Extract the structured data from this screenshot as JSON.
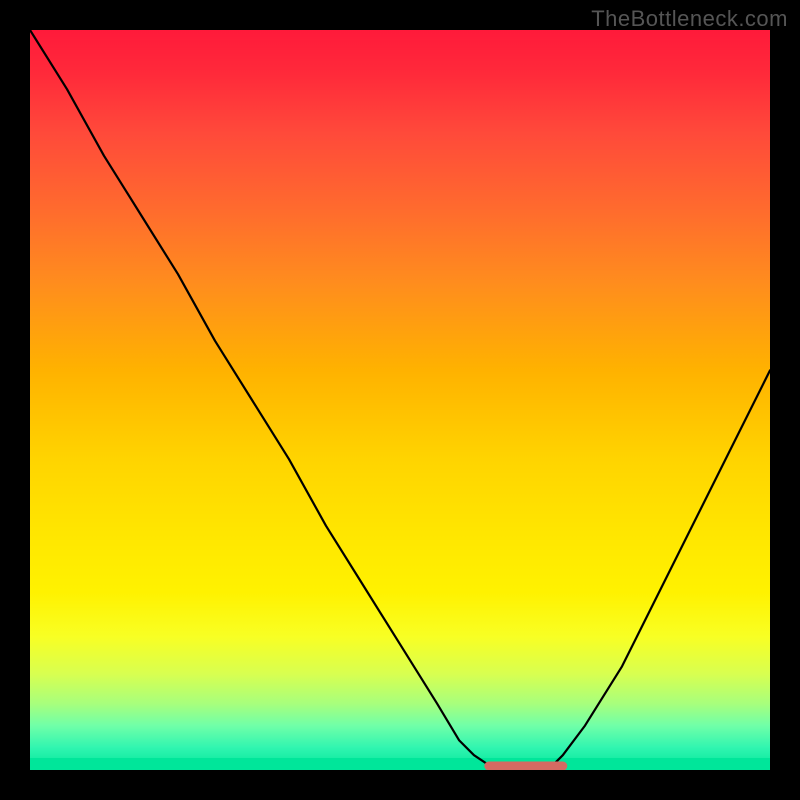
{
  "watermark": "TheBottleneck.com",
  "chart_data": {
    "type": "line",
    "title": "",
    "xlabel": "",
    "ylabel": "",
    "xlim": [
      0,
      100
    ],
    "ylim": [
      0,
      100
    ],
    "grid": false,
    "legend": false,
    "annotations": [],
    "series": [
      {
        "name": "bottleneck-curve",
        "x": [
          0,
          5,
          10,
          15,
          20,
          25,
          30,
          35,
          40,
          45,
          50,
          55,
          58,
          60,
          63,
          66,
          70,
          72,
          75,
          80,
          85,
          90,
          95,
          100
        ],
        "y": [
          100,
          92,
          83,
          75,
          67,
          58,
          50,
          42,
          33,
          25,
          17,
          9,
          4,
          2,
          0,
          0,
          0,
          2,
          6,
          14,
          24,
          34,
          44,
          54
        ]
      }
    ],
    "optimal_range": {
      "x_start": 62,
      "x_end": 72,
      "y": 0
    },
    "background_gradient": {
      "orientation": "vertical",
      "stops": [
        {
          "pos": 0.0,
          "color": "#ff1a3a"
        },
        {
          "pos": 0.46,
          "color": "#ffb200"
        },
        {
          "pos": 0.76,
          "color": "#fff200"
        },
        {
          "pos": 1.0,
          "color": "#00e69a"
        }
      ]
    }
  }
}
